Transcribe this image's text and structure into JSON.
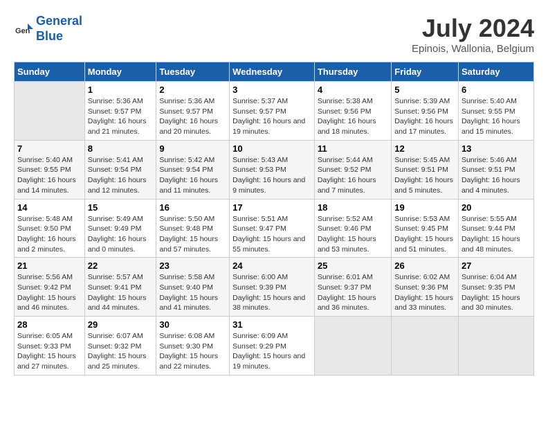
{
  "header": {
    "logo_line1": "General",
    "logo_line2": "Blue",
    "title": "July 2024",
    "subtitle": "Epinois, Wallonia, Belgium"
  },
  "weekdays": [
    "Sunday",
    "Monday",
    "Tuesday",
    "Wednesday",
    "Thursday",
    "Friday",
    "Saturday"
  ],
  "weeks": [
    [
      {
        "day": "",
        "content": ""
      },
      {
        "day": "1",
        "content": "Sunrise: 5:36 AM\nSunset: 9:57 PM\nDaylight: 16 hours\nand 21 minutes."
      },
      {
        "day": "2",
        "content": "Sunrise: 5:36 AM\nSunset: 9:57 PM\nDaylight: 16 hours\nand 20 minutes."
      },
      {
        "day": "3",
        "content": "Sunrise: 5:37 AM\nSunset: 9:57 PM\nDaylight: 16 hours\nand 19 minutes."
      },
      {
        "day": "4",
        "content": "Sunrise: 5:38 AM\nSunset: 9:56 PM\nDaylight: 16 hours\nand 18 minutes."
      },
      {
        "day": "5",
        "content": "Sunrise: 5:39 AM\nSunset: 9:56 PM\nDaylight: 16 hours\nand 17 minutes."
      },
      {
        "day": "6",
        "content": "Sunrise: 5:40 AM\nSunset: 9:55 PM\nDaylight: 16 hours\nand 15 minutes."
      }
    ],
    [
      {
        "day": "7",
        "content": "Sunrise: 5:40 AM\nSunset: 9:55 PM\nDaylight: 16 hours\nand 14 minutes."
      },
      {
        "day": "8",
        "content": "Sunrise: 5:41 AM\nSunset: 9:54 PM\nDaylight: 16 hours\nand 12 minutes."
      },
      {
        "day": "9",
        "content": "Sunrise: 5:42 AM\nSunset: 9:54 PM\nDaylight: 16 hours\nand 11 minutes."
      },
      {
        "day": "10",
        "content": "Sunrise: 5:43 AM\nSunset: 9:53 PM\nDaylight: 16 hours\nand 9 minutes."
      },
      {
        "day": "11",
        "content": "Sunrise: 5:44 AM\nSunset: 9:52 PM\nDaylight: 16 hours\nand 7 minutes."
      },
      {
        "day": "12",
        "content": "Sunrise: 5:45 AM\nSunset: 9:51 PM\nDaylight: 16 hours\nand 5 minutes."
      },
      {
        "day": "13",
        "content": "Sunrise: 5:46 AM\nSunset: 9:51 PM\nDaylight: 16 hours\nand 4 minutes."
      }
    ],
    [
      {
        "day": "14",
        "content": "Sunrise: 5:48 AM\nSunset: 9:50 PM\nDaylight: 16 hours\nand 2 minutes."
      },
      {
        "day": "15",
        "content": "Sunrise: 5:49 AM\nSunset: 9:49 PM\nDaylight: 16 hours\nand 0 minutes."
      },
      {
        "day": "16",
        "content": "Sunrise: 5:50 AM\nSunset: 9:48 PM\nDaylight: 15 hours\nand 57 minutes."
      },
      {
        "day": "17",
        "content": "Sunrise: 5:51 AM\nSunset: 9:47 PM\nDaylight: 15 hours\nand 55 minutes."
      },
      {
        "day": "18",
        "content": "Sunrise: 5:52 AM\nSunset: 9:46 PM\nDaylight: 15 hours\nand 53 minutes."
      },
      {
        "day": "19",
        "content": "Sunrise: 5:53 AM\nSunset: 9:45 PM\nDaylight: 15 hours\nand 51 minutes."
      },
      {
        "day": "20",
        "content": "Sunrise: 5:55 AM\nSunset: 9:44 PM\nDaylight: 15 hours\nand 48 minutes."
      }
    ],
    [
      {
        "day": "21",
        "content": "Sunrise: 5:56 AM\nSunset: 9:42 PM\nDaylight: 15 hours\nand 46 minutes."
      },
      {
        "day": "22",
        "content": "Sunrise: 5:57 AM\nSunset: 9:41 PM\nDaylight: 15 hours\nand 44 minutes."
      },
      {
        "day": "23",
        "content": "Sunrise: 5:58 AM\nSunset: 9:40 PM\nDaylight: 15 hours\nand 41 minutes."
      },
      {
        "day": "24",
        "content": "Sunrise: 6:00 AM\nSunset: 9:39 PM\nDaylight: 15 hours\nand 38 minutes."
      },
      {
        "day": "25",
        "content": "Sunrise: 6:01 AM\nSunset: 9:37 PM\nDaylight: 15 hours\nand 36 minutes."
      },
      {
        "day": "26",
        "content": "Sunrise: 6:02 AM\nSunset: 9:36 PM\nDaylight: 15 hours\nand 33 minutes."
      },
      {
        "day": "27",
        "content": "Sunrise: 6:04 AM\nSunset: 9:35 PM\nDaylight: 15 hours\nand 30 minutes."
      }
    ],
    [
      {
        "day": "28",
        "content": "Sunrise: 6:05 AM\nSunset: 9:33 PM\nDaylight: 15 hours\nand 27 minutes."
      },
      {
        "day": "29",
        "content": "Sunrise: 6:07 AM\nSunset: 9:32 PM\nDaylight: 15 hours\nand 25 minutes."
      },
      {
        "day": "30",
        "content": "Sunrise: 6:08 AM\nSunset: 9:30 PM\nDaylight: 15 hours\nand 22 minutes."
      },
      {
        "day": "31",
        "content": "Sunrise: 6:09 AM\nSunset: 9:29 PM\nDaylight: 15 hours\nand 19 minutes."
      },
      {
        "day": "",
        "content": ""
      },
      {
        "day": "",
        "content": ""
      },
      {
        "day": "",
        "content": ""
      }
    ]
  ]
}
